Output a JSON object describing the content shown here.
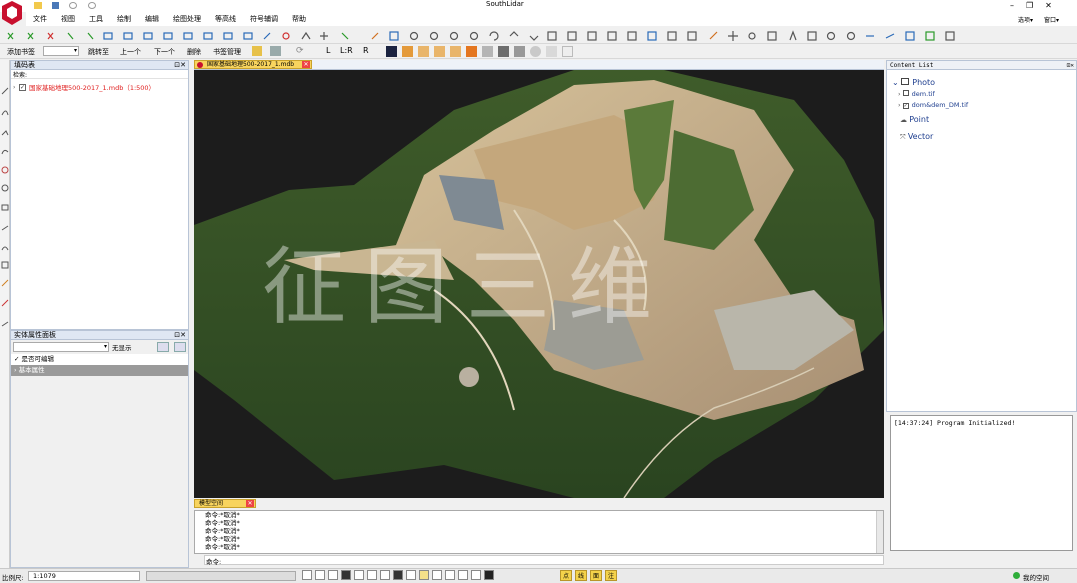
{
  "app": {
    "title": "SouthLidar",
    "right_menu": [
      "选项▾",
      "窗口▾"
    ]
  },
  "menu": [
    "文件",
    "视图",
    "工具",
    "绘制",
    "编辑",
    "绘图处理",
    "等高线",
    "符号辅调",
    "帮助"
  ],
  "bookmark_bar": {
    "add": "添加书签",
    "goto": "跳转至",
    "prev": "上一个",
    "next": "下一个",
    "delete": "删除",
    "manage": "书签管理",
    "l": "L",
    "lr": "L:R",
    "r": "R"
  },
  "layer_panel": {
    "title": "填码表",
    "search": "检索:",
    "item": "国家基础地理500-2017_1.mdb（1:500）"
  },
  "prop_panel": {
    "title": "实体属性面板",
    "display": "无显示",
    "editable": "是否可编辑",
    "basic": "基本属性"
  },
  "doc_tab": {
    "title": "国家基础地理500-2017_1.mdb"
  },
  "content": {
    "title": "Content List",
    "photo": "Photo",
    "dem": "dem.tif",
    "dom": "dom&dem_DM.tif",
    "point": "Point",
    "vector": "Vector"
  },
  "log": {
    "message": "[14:37:24] Program Initialized!"
  },
  "cmd": {
    "tab": "模型空间",
    "lines": [
      "命令:*取消*",
      "命令:*取消*",
      "命令:*取消*",
      "命令:*取消*",
      "命令:*取消*"
    ],
    "prompt": "命令:"
  },
  "status": {
    "scale_label": "比例尺:",
    "scale": "1:1079",
    "space": "我的空间",
    "modes": [
      "点",
      "线",
      "面",
      "注"
    ]
  },
  "watermark": "征图三维",
  "colors": {
    "accent": "#c8102e",
    "tabtab": "#f8d45e",
    "red_text": "#e02020"
  }
}
